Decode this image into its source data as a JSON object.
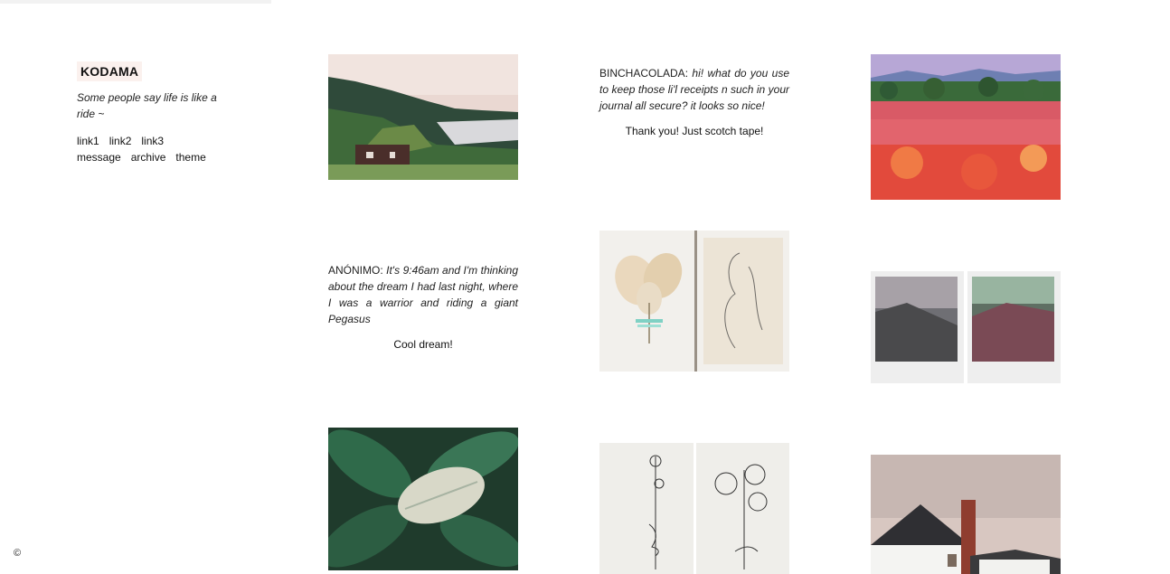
{
  "blog": {
    "title": "KODAMA",
    "description": "Some people say life is like a ride ~",
    "nav_row1": [
      "link1",
      "link2",
      "link3"
    ],
    "nav_row2": [
      "message",
      "archive",
      "theme"
    ],
    "copyright": "©"
  },
  "posts": {
    "ask1": {
      "asker": "ANÓNIMO:",
      "question": "It's 9:46am and I'm thinking about the dream I had last night, where I was a warrior and riding a giant Pegasus",
      "answer": "Cool dream!"
    },
    "ask2": {
      "asker": "BINCHACOLADA:",
      "question": "hi! what do you use to keep those li'l receipts n such in your journal all secure? it looks so nice!",
      "answer": "Thank you! Just scotch tape!"
    }
  }
}
